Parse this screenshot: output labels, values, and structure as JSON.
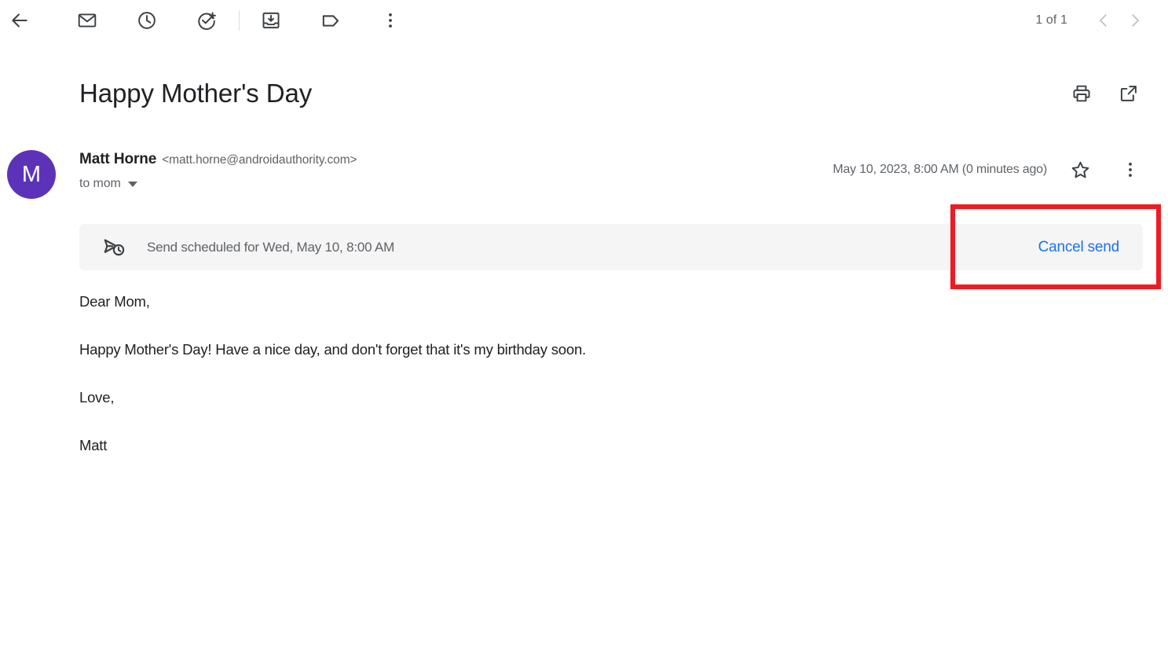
{
  "toolbar": {
    "back_label": "Back",
    "actions": [
      {
        "name": "mark-unread-icon",
        "label": "Mark as unread"
      },
      {
        "name": "snooze-icon",
        "label": "Snooze"
      },
      {
        "name": "add-to-tasks-icon",
        "label": "Add to tasks"
      },
      {
        "name": "archive-icon",
        "label": "Archive"
      },
      {
        "name": "label-icon",
        "label": "Labels"
      },
      {
        "name": "more-options-icon",
        "label": "More"
      }
    ],
    "pager": {
      "count": "1 of 1",
      "prev_label": "Older",
      "next_label": "Newer"
    }
  },
  "subject": {
    "title": "Happy Mother's Day",
    "print_label": "Print all",
    "popout_label": "In new window"
  },
  "sender": {
    "avatar_initial": "M",
    "avatar_color": "#5c33b8",
    "name": "Matt Horne",
    "email": "<matt.horne@androidauthority.com>",
    "recipient": "to mom",
    "timestamp": "May 10, 2023, 8:00 AM (0 minutes ago)",
    "star_label": "Not starred",
    "more_label": "More"
  },
  "banner": {
    "icon": "scheduled-send-icon",
    "text": "Send scheduled for Wed, May 10, 8:00 AM",
    "cancel_label": "Cancel send",
    "cancel_color": "#1a73e8",
    "background": "#f5f5f5"
  },
  "highlight": {
    "color": "#ee1b23",
    "target": "cancel-send-button"
  },
  "message_body": {
    "lines": [
      "Dear Mom,",
      "Happy Mother's Day! Have a nice day, and don't forget that it's my birthday soon.",
      "Love,",
      "Matt"
    ]
  }
}
